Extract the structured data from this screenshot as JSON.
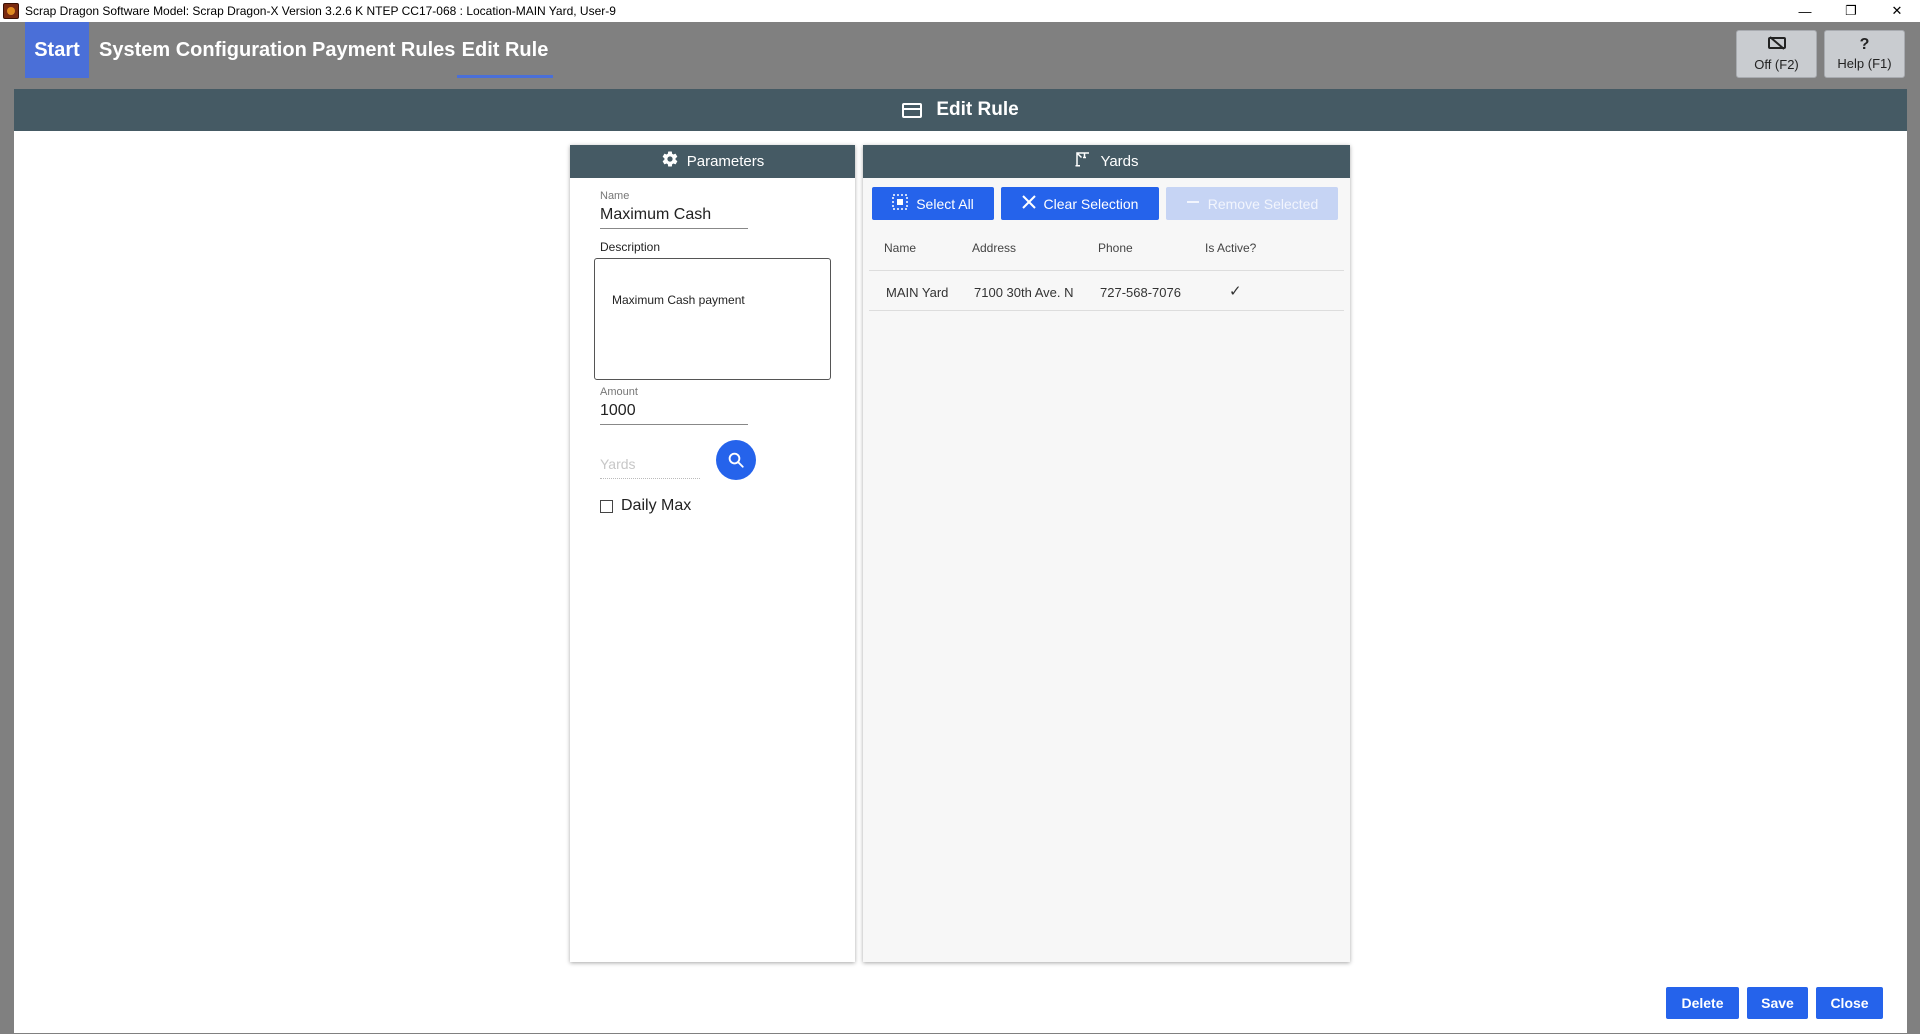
{
  "window": {
    "title": "Scrap Dragon Software Model: Scrap Dragon-X Version 3.2.6 K NTEP CC17-068 : Location-MAIN Yard, User-9",
    "minimize": "—",
    "maximize": "❐",
    "close": "✕"
  },
  "nav": {
    "start": "Start",
    "system_configuration": "System Configuration",
    "payment_rules": "Payment Rules",
    "edit_rule": "Edit Rule"
  },
  "tools": {
    "off_label": "Off (F2)",
    "help_label": "Help (F1)",
    "help_icon": "?"
  },
  "page": {
    "title": "Edit Rule"
  },
  "parameters": {
    "header": "Parameters",
    "name_label": "Name",
    "name_value": "Maximum Cash",
    "description_label": "Description",
    "description_value": "Maximum Cash payment",
    "amount_label": "Amount",
    "amount_value": "1000",
    "yards_placeholder": "Yards",
    "daily_max_label": "Daily Max",
    "daily_max_checked": false
  },
  "yards_panel": {
    "header": "Yards",
    "select_all": "Select All",
    "clear_selection": "Clear Selection",
    "remove_selected": "Remove Selected",
    "columns": [
      "Name",
      "Address",
      "Phone",
      "Is Active?"
    ],
    "rows": [
      {
        "name": "MAIN Yard",
        "address": "7100 30th Ave. N",
        "phone": "727-568-7076",
        "is_active": "✓"
      }
    ]
  },
  "footer": {
    "delete": "Delete",
    "save": "Save",
    "close": "Close"
  },
  "colors": {
    "accent": "#2563eb",
    "header_bg": "#455a64",
    "start_tab": "#4a6fd8"
  }
}
